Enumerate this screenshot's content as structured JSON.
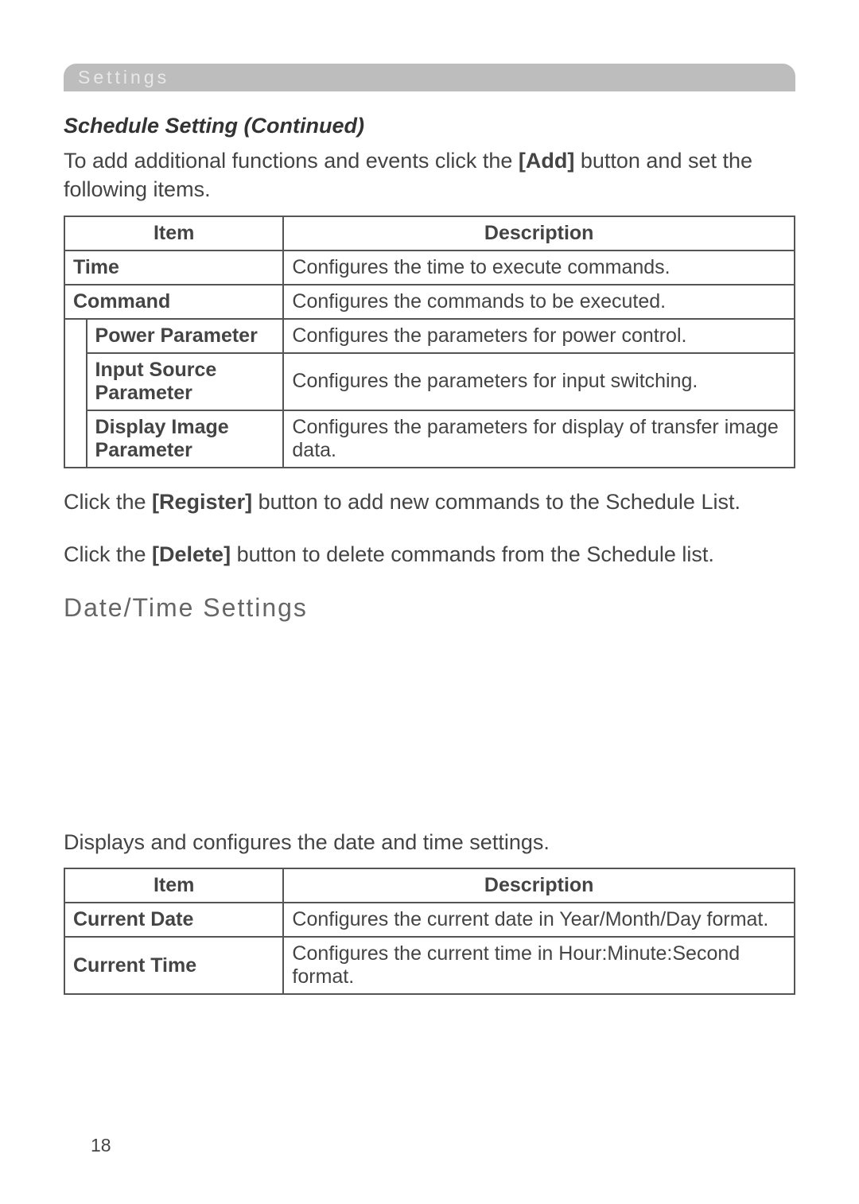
{
  "header_bar": "Settings",
  "section_title": "Schedule Setting (Continued)",
  "intro_pre": "To add additional functions and events click the ",
  "intro_bold": "[Add]",
  "intro_post": " button and set the following items.",
  "table1": {
    "head_item": "Item",
    "head_desc": "Description",
    "rows": [
      {
        "item": "Time",
        "desc": "Configures the time to execute commands."
      },
      {
        "item": "Command",
        "desc": "Configures the commands to be executed."
      }
    ],
    "subrows": [
      {
        "item": "Power Parameter",
        "desc": "Configures the parameters for power control."
      },
      {
        "item": "Input Source Parameter",
        "desc": "Configures the parameters for input switching."
      },
      {
        "item": "Display Image Parameter",
        "desc": "Configures the parameters for display of transfer image data."
      }
    ]
  },
  "inst1_pre": "Click the ",
  "inst1_bold": "[Register]",
  "inst1_post": " button to add new commands to the Schedule List.",
  "inst2_pre": "Click the ",
  "inst2_bold": "[Delete]",
  "inst2_post": " button to delete commands from the Schedule list.",
  "heading2": "Date/Time Settings",
  "dt_intro": "Displays and configures the date and time settings.",
  "table2": {
    "head_item": "Item",
    "head_desc": "Description",
    "rows": [
      {
        "item": "Current Date",
        "desc": "Configures the current date in Year/Month/Day format."
      },
      {
        "item": "Current Time",
        "desc": "Configures the current time in Hour:Minute:Second format."
      }
    ]
  },
  "page_number": "18"
}
